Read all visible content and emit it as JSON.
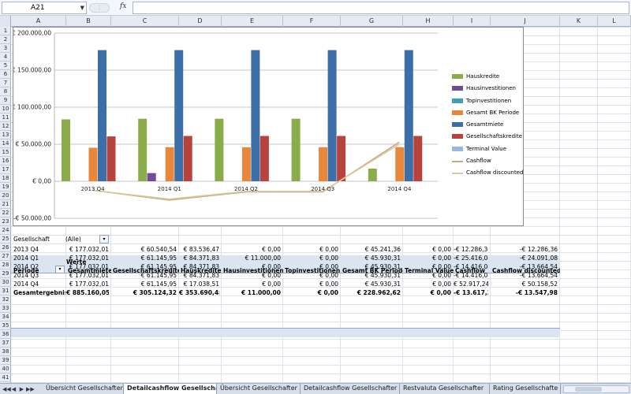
{
  "formula_bar": {
    "name_box": "A21",
    "fx_label": "fx",
    "formula": ""
  },
  "columns": [
    "A",
    "B",
    "C",
    "D",
    "E",
    "F",
    "G",
    "H",
    "I",
    "J",
    "K",
    "L"
  ],
  "rows": [
    "1",
    "2",
    "3",
    "4",
    "5",
    "6",
    "7",
    "8",
    "9",
    "10",
    "11",
    "12",
    "13",
    "14",
    "15",
    "16",
    "17",
    "18",
    "19",
    "20",
    "21",
    "22",
    "23",
    "24",
    "25",
    "26",
    "27",
    "28",
    "29",
    "30",
    "31",
    "32",
    "33",
    "34",
    "35",
    "36",
    "37",
    "38",
    "39",
    "40",
    "41"
  ],
  "chart_data": {
    "type": "bar",
    "categories": [
      "2013 Q4",
      "2014 Q1",
      "2014 Q2",
      "2014 Q3",
      "2014 Q4"
    ],
    "y_tick_labels": [
      "€ 200.000,00",
      "€ 150.000,00",
      "€ 100.000,00",
      "€ 50.000,00",
      "€ 0,00",
      "-€ 50.000,00"
    ],
    "ylim": [
      -50000,
      200000
    ],
    "y_ticks": [
      200000,
      150000,
      100000,
      50000,
      0,
      -50000
    ],
    "grid": true,
    "legend_position": "right",
    "series": [
      {
        "name": "Hauskredite",
        "kind": "bar",
        "color": "#8aac4a",
        "values": [
          83536.47,
          84371.83,
          84371.83,
          84371.83,
          17038.51
        ]
      },
      {
        "name": "Hausinvestitionen",
        "kind": "bar",
        "color": "#6e4c9a",
        "values": [
          0,
          11000,
          0,
          0,
          0
        ]
      },
      {
        "name": "Topinvestitionen",
        "kind": "bar",
        "color": "#3aa0b8",
        "values": [
          0,
          0,
          0,
          0,
          0
        ]
      },
      {
        "name": "Gesamt BK Periode",
        "kind": "bar",
        "color": "#e8873a",
        "values": [
          45241.36,
          45930.31,
          45930.31,
          45930.31,
          45930.31
        ]
      },
      {
        "name": "Gesamtmiete",
        "kind": "bar",
        "color": "#3c6ea8",
        "values": [
          177032.01,
          177032.01,
          177032.01,
          177032.01,
          177032.01
        ]
      },
      {
        "name": "Gesellschaftskredite",
        "kind": "bar",
        "color": "#b8433e",
        "values": [
          60540.54,
          61145.95,
          61145.95,
          61145.95,
          61145.95
        ]
      },
      {
        "name": "Terminal Value",
        "kind": "bar",
        "color": "#9bb7dc",
        "values": [
          0,
          0,
          0,
          0,
          0
        ]
      },
      {
        "name": "Cashflow",
        "kind": "line",
        "color": "#c8a97a",
        "values": [
          -12286.36,
          -25416.08,
          -14416.08,
          -14416.08,
          52917.24
        ]
      },
      {
        "name": "Cashflow discounted",
        "kind": "line",
        "color": "#d8cba0",
        "values": [
          -12286.36,
          -24091.08,
          -13664.54,
          -13664.54,
          50158.52
        ]
      }
    ]
  },
  "filter": {
    "label": "Gesellschaft",
    "value": "(Alle)",
    "dropdown_glyph": "▾"
  },
  "pivot": {
    "values_label": "Werte",
    "row_label": "Periode",
    "headers": [
      "Gesamtmiete",
      "Gesellschaftskredite",
      "Hauskredite",
      "Hausinvestitionen",
      "Topinvestitionen",
      "Gesamt BK Periode",
      "Terminal Value",
      "Cashflow",
      "Cashflow discounted"
    ],
    "rows": [
      {
        "label": "2013 Q4",
        "cells": [
          "€ 177.032,01",
          "€ 60.540,54",
          "€ 83.536,47",
          "€ 0,00",
          "€ 0,00",
          "€ 45.241,36",
          "€ 0,00",
          "-€ 12.286,36",
          "-€ 12.286,36"
        ]
      },
      {
        "label": "2014 Q1",
        "cells": [
          "€ 177.032,01",
          "€ 61.145,95",
          "€ 84.371,83",
          "€ 11.000,00",
          "€ 0,00",
          "€ 45.930,31",
          "€ 0,00",
          "-€ 25.416,08",
          "-€ 24.091,08"
        ]
      },
      {
        "label": "2014 Q2",
        "cells": [
          "€ 177.032,01",
          "€ 61.145,95",
          "€ 84.371,83",
          "€ 0,00",
          "€ 0,00",
          "€ 45.930,31",
          "€ 0,00",
          "-€ 14.416,08",
          "-€ 13.664,54"
        ]
      },
      {
        "label": "2014 Q3",
        "cells": [
          "€ 177.032,01",
          "€ 61.145,95",
          "€ 84.371,83",
          "€ 0,00",
          "€ 0,00",
          "€ 45.930,31",
          "€ 0,00",
          "-€ 14.416,08",
          "-€ 13.664,54"
        ]
      },
      {
        "label": "2014 Q4",
        "cells": [
          "€ 177.032,01",
          "€ 61.145,95",
          "€ 17.038,51",
          "€ 0,00",
          "€ 0,00",
          "€ 45.930,31",
          "€ 0,00",
          "€ 52.917,24",
          "€ 50.158,52"
        ]
      }
    ],
    "total": {
      "label": "Gesamtergebnis",
      "cells": [
        "€ 885.160,05",
        "€ 305.124,32",
        "€ 353.690,48",
        "€ 11.000,00",
        "€ 0,00",
        "€ 228.962,62",
        "€ 0,00",
        "-€ 13.617,37",
        "-€ 13.547,98"
      ]
    }
  },
  "sheet_tabs": {
    "nav": [
      "◀◀",
      "◀",
      "▶",
      "▶▶"
    ],
    "tabs": [
      "Übersicht Gesellschaften",
      "Detailcashflow Gesellschaft",
      "Übersicht Gesellschafter",
      "Detailcashflow Gesellschafter",
      "Restvaluta Gesellschafter",
      "Rating Gesellschafte"
    ],
    "active_index": 1
  }
}
